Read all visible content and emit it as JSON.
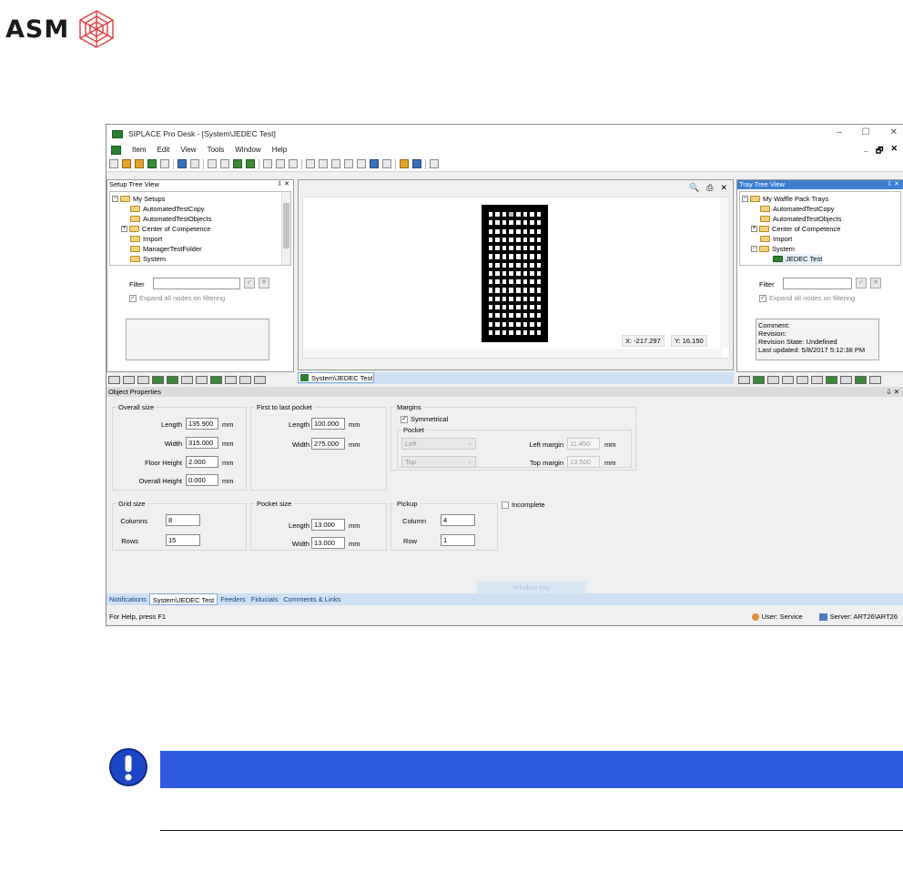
{
  "logo": {
    "text": "ASM"
  },
  "window": {
    "title": "SIPLACE Pro Desk - [System\\JEDEC Test]",
    "controls": [
      "–",
      "☐",
      "✕"
    ]
  },
  "menu": {
    "items": [
      "Item",
      "Edit",
      "View",
      "Tools",
      "Window",
      "Help"
    ]
  },
  "setup_tree": {
    "header": "Setup Tree View",
    "pin": "⇩ ✕",
    "items": [
      {
        "label": "My Setups",
        "level": 0,
        "expander": "−"
      },
      {
        "label": "AutomatedTestCopy",
        "level": 1,
        "expander": ""
      },
      {
        "label": "AutomatedTestObjects",
        "level": 1,
        "expander": ""
      },
      {
        "label": "Center of Competence",
        "level": 1,
        "expander": "+"
      },
      {
        "label": "Import",
        "level": 1,
        "expander": ""
      },
      {
        "label": "ManagerTestFolder",
        "level": 1,
        "expander": ""
      },
      {
        "label": "System",
        "level": 1,
        "expander": ""
      }
    ],
    "filter_label": "Filter",
    "expand_label": "Expand all nodes on filtering"
  },
  "center": {
    "coord_x": "X:  -217.297",
    "coord_y": "Y:  16.150",
    "doc_tab": "System\\JEDEC Test"
  },
  "tray_tree": {
    "header": "Tray Tree View",
    "pin": "⇩ ✕",
    "items": [
      {
        "label": "My Waffle Pack Trays",
        "level": 0,
        "expander": "−"
      },
      {
        "label": "AutomatedTestCopy",
        "level": 1,
        "expander": ""
      },
      {
        "label": "AutomatedTestObjects",
        "level": 1,
        "expander": ""
      },
      {
        "label": "Center of Competence",
        "level": 1,
        "expander": "+"
      },
      {
        "label": "Import",
        "level": 1,
        "expander": ""
      },
      {
        "label": "System",
        "level": 1,
        "expander": "−"
      },
      {
        "label": "JEDEC Test",
        "level": 2,
        "expander": ""
      }
    ],
    "filter_label": "Filter",
    "expand_label": "Expand all nodes on filtering",
    "info": {
      "comment": "Comment:",
      "revision": "Revision:",
      "state": "Revision State: Undefined",
      "updated": "Last updated: 5/8/2017 5:12:38 PM"
    }
  },
  "props": {
    "header": "Object Properties",
    "pin": "⇩ ✕",
    "overall": {
      "title": "Overall size",
      "length_label": "Length",
      "length": "135.900",
      "width_label": "Width",
      "width": "315.000",
      "floor_label": "Floor Height",
      "floor": "2.000",
      "overall_label": "Overall Height",
      "overall": "0.000",
      "unit": "mm"
    },
    "first_last": {
      "title": "First to last pocket",
      "length_label": "Length",
      "length": "100.000",
      "width_label": "Width",
      "width": "275.000",
      "unit": "mm"
    },
    "margins": {
      "title": "Margins",
      "symmetrical": "Symmetrical",
      "pocket_title": "Pocket",
      "horiz_select": "Left",
      "vert_select": "Top",
      "left_label": "Left margin",
      "left": "11.450",
      "top_label": "Top margin",
      "top": "13.500",
      "unit": "mm"
    },
    "grid": {
      "title": "Grid size",
      "columns_label": "Columns",
      "columns": "8",
      "rows_label": "Rows",
      "rows": "15"
    },
    "pocket_size": {
      "title": "Pocket size",
      "length_label": "Length",
      "length": "13.000",
      "width_label": "Width",
      "width": "13.000",
      "unit": "mm"
    },
    "pickup": {
      "title": "Pickup",
      "column_label": "Column",
      "column": "4",
      "row_label": "Row",
      "row": "1"
    },
    "incomplete": "Incomplete",
    "window_hint": "Window tray"
  },
  "bottom_tabs": [
    "Notifications",
    "System\\JEDEC Test",
    "Feeders",
    "Fiducials",
    "Comments & Links"
  ],
  "status": {
    "help": "For Help, press F1",
    "user": "User:  Service",
    "server": "Server:  ART26\\ART26"
  },
  "tray_grid": {
    "columns": 8,
    "rows": 15,
    "pickup_column": 4,
    "pickup_row": 1
  },
  "colors": {
    "accent": "#3c7fd1",
    "notice": "#2f5be0"
  }
}
